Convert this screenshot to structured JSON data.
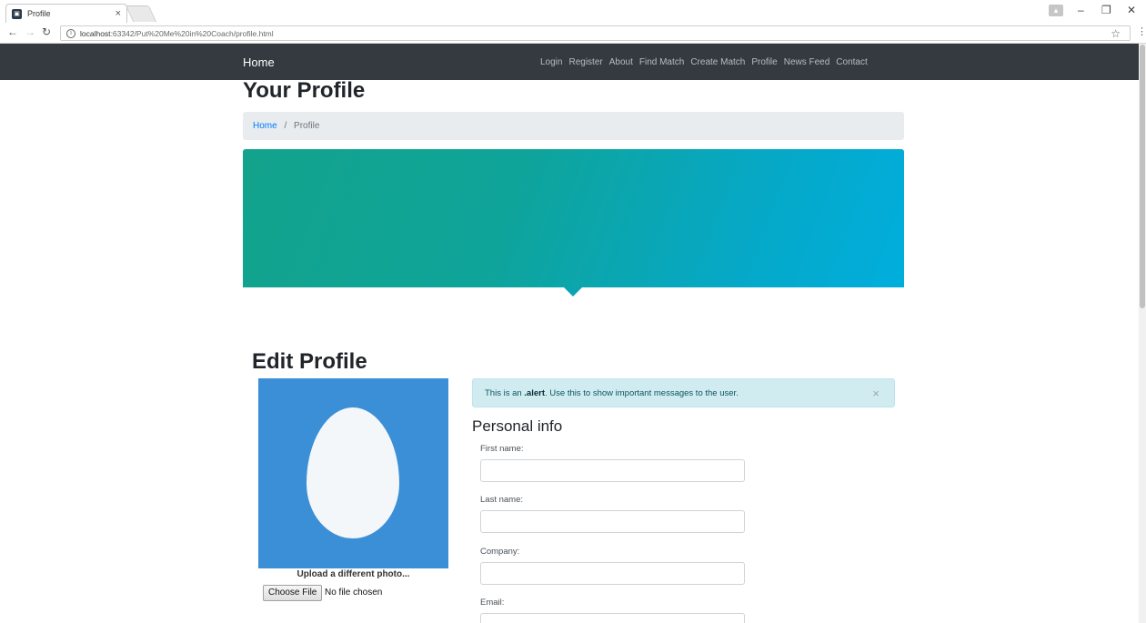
{
  "browser": {
    "tab_title": "Profile",
    "tab_close": "×",
    "url_host": "localhost",
    "url_rest": ":63342/Put%20Me%20in%20Coach/profile.html"
  },
  "navbar": {
    "brand": "Home",
    "links": [
      "Login",
      "Register",
      "About",
      "Find Match",
      "Create Match",
      "Profile",
      "News Feed",
      "Contact"
    ]
  },
  "page": {
    "title": "Your Profile",
    "breadcrumb": {
      "home": "Home",
      "separator": "/",
      "current": "Profile"
    }
  },
  "edit": {
    "title": "Edit Profile",
    "upload_label": "Upload a different photo...",
    "choose_file": "Choose File",
    "no_file": "No file chosen"
  },
  "alert": {
    "prefix": "This is an ",
    "strong": ".alert",
    "suffix": ". Use this to show important messages to the user.",
    "close": "×"
  },
  "personal_info": {
    "title": "Personal info",
    "fields": [
      {
        "label": "First name:",
        "value": ""
      },
      {
        "label": "Last name:",
        "value": ""
      },
      {
        "label": "Company:",
        "value": ""
      },
      {
        "label": "Email:",
        "value": ""
      }
    ]
  },
  "colors": {
    "navbar_bg": "#343a40",
    "hero_start": "#13a38c",
    "hero_end": "#00aedd",
    "avatar_bg": "#3b8fd6",
    "alert_bg": "#d1ecf1",
    "link": "#007bff"
  }
}
